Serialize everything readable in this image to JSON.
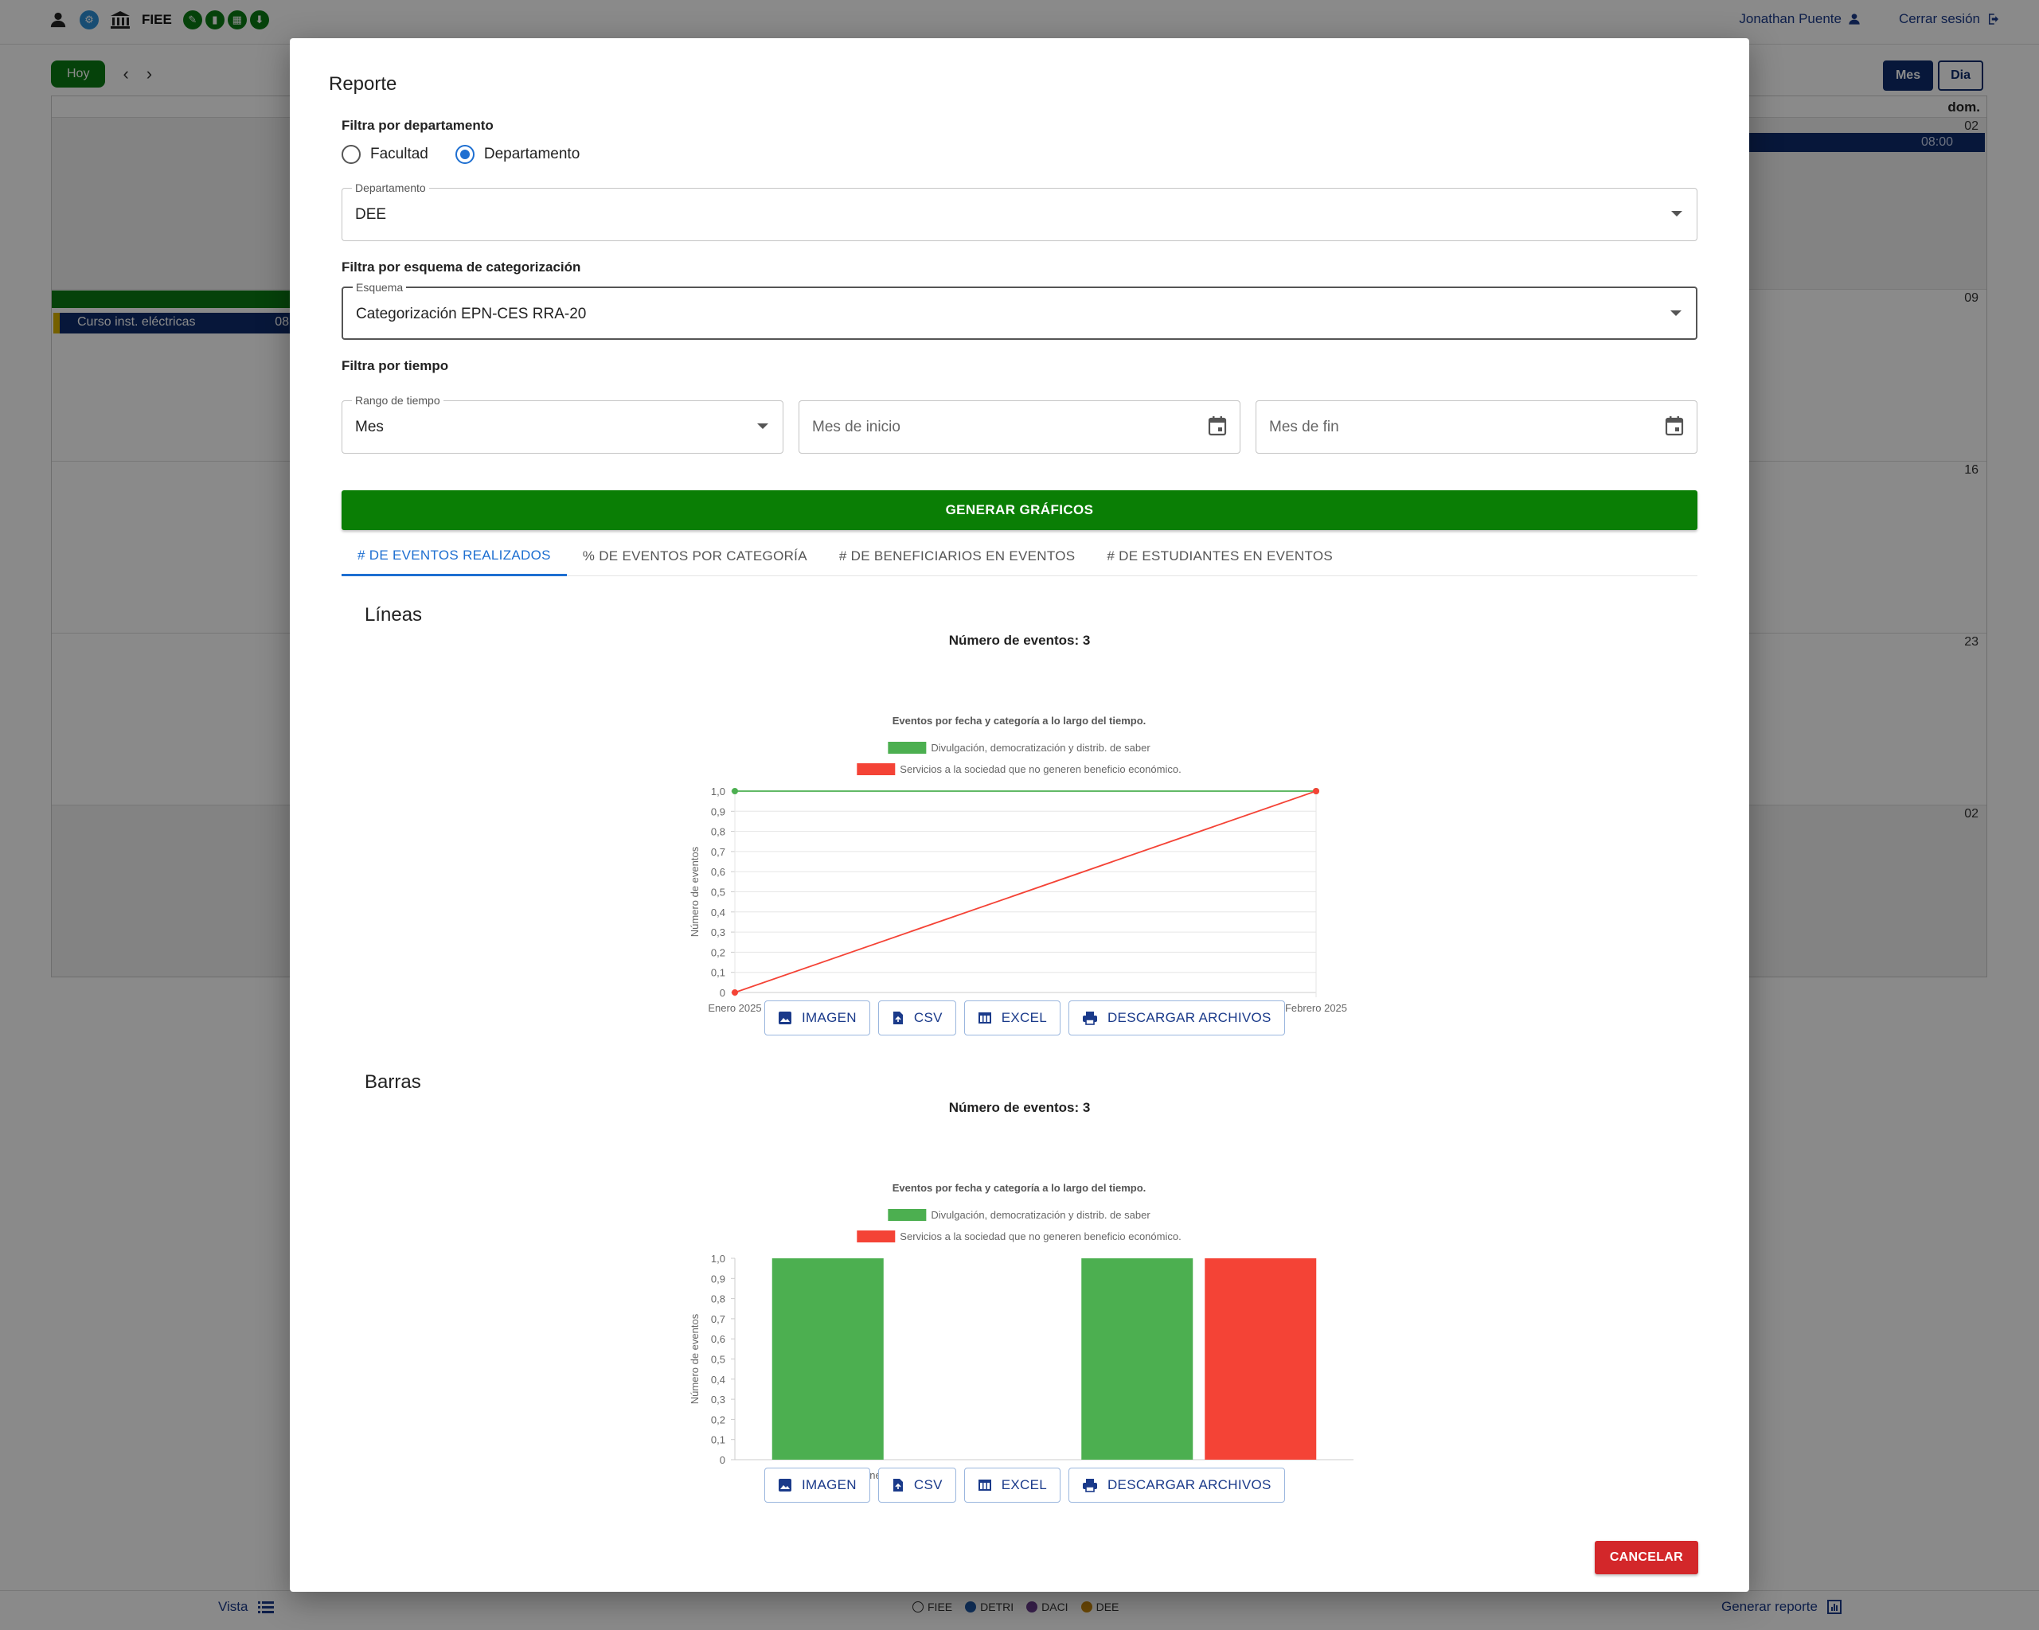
{
  "topbar": {
    "org_name": "FIEE",
    "user_name": "Jonathan Puente",
    "logout_label": "Cerrar sesión"
  },
  "calendar": {
    "today_label": "Hoy",
    "view_month": "Mes",
    "view_day": "Dia",
    "weekday_header": "dom.",
    "day_numbers": [
      "02",
      "09",
      "16",
      "23",
      "02"
    ],
    "event_left": "Curso inst. eléctricas",
    "event_left_time": "08",
    "event_right_time": "08:00"
  },
  "footer": {
    "vista_label": "Vista",
    "legend": [
      {
        "label": "FIEE",
        "color": "#ffffff"
      },
      {
        "label": "DETRI",
        "color": "#1e5aa8"
      },
      {
        "label": "DACI",
        "color": "#6a3b8e"
      },
      {
        "label": "DEE",
        "color": "#c8860a"
      }
    ],
    "report_label": "Generar reporte"
  },
  "dialog": {
    "title": "Reporte",
    "dept_filter_label": "Filtra por departamento",
    "radio_facultad": "Facultad",
    "radio_departamento": "Departamento",
    "dept_field_label": "Departamento",
    "dept_field_value": "DEE",
    "scheme_filter_label": "Filtra por esquema de categorización",
    "scheme_field_label": "Esquema",
    "scheme_field_value": "Categorización EPN-CES RRA-20",
    "time_filter_label": "Filtra por tiempo",
    "range_field_label": "Rango de tiempo",
    "range_field_value": "Mes",
    "start_placeholder": "Mes de inicio",
    "end_placeholder": "Mes de fin",
    "generate_button": "GENERAR GRÁFICOS",
    "tabs": [
      "# DE EVENTOS REALIZADOS",
      "% DE EVENTOS POR CATEGORÍA",
      "# DE BENEFICIARIOS EN EVENTOS",
      "# DE ESTUDIANTES EN EVENTOS"
    ],
    "line_heading": "Líneas",
    "bar_heading": "Barras",
    "events_count": "Número de eventos: 3",
    "btn_image": "IMAGEN",
    "btn_csv": "CSV",
    "btn_excel": "EXCEL",
    "btn_download": "DESCARGAR ARCHIVOS",
    "cancel_button": "CANCELAR"
  },
  "colors": {
    "series_green": "#4caf50",
    "series_red": "#f44336",
    "primary_blue": "#1e6fd1",
    "generate_green": "#0a7e05",
    "cancel_red": "#d3272a"
  },
  "chart_data": [
    {
      "type": "line",
      "title": "Eventos por fecha y categoría a lo largo del tiempo.",
      "xlabel": "Fechas",
      "ylabel": "Número de eventos",
      "categories": [
        "Enero 2025",
        "Febrero 2025"
      ],
      "ylim": [
        0,
        1
      ],
      "yticks": [
        "0",
        "0,1",
        "0,2",
        "0,3",
        "0,4",
        "0,5",
        "0,6",
        "0,7",
        "0,8",
        "0,9",
        "1,0"
      ],
      "legend_position": "top",
      "grid": true,
      "series": [
        {
          "name": "Divulgación, democratización y distrib. de saber",
          "color": "#4caf50",
          "values": [
            1,
            1
          ]
        },
        {
          "name": "Servicios a la sociedad que no generen beneficio económico.",
          "color": "#f44336",
          "values": [
            0,
            1
          ]
        }
      ]
    },
    {
      "type": "bar",
      "title": "Eventos por fecha y categoría a lo largo del tiempo.",
      "xlabel": "Fechas",
      "ylabel": "Número de eventos",
      "categories": [
        "Enero 2025",
        "Febrero 2025"
      ],
      "ylim": [
        0,
        1
      ],
      "yticks": [
        "0",
        "0,1",
        "0,2",
        "0,3",
        "0,4",
        "0,5",
        "0,6",
        "0,7",
        "0,8",
        "0,9",
        "1,0"
      ],
      "legend_position": "top",
      "grid": false,
      "series": [
        {
          "name": "Divulgación, democratización y distrib. de saber",
          "color": "#4caf50",
          "values": [
            1,
            1
          ]
        },
        {
          "name": "Servicios a la sociedad que no generen beneficio económico.",
          "color": "#f44336",
          "values": [
            0,
            1
          ]
        }
      ]
    }
  ]
}
